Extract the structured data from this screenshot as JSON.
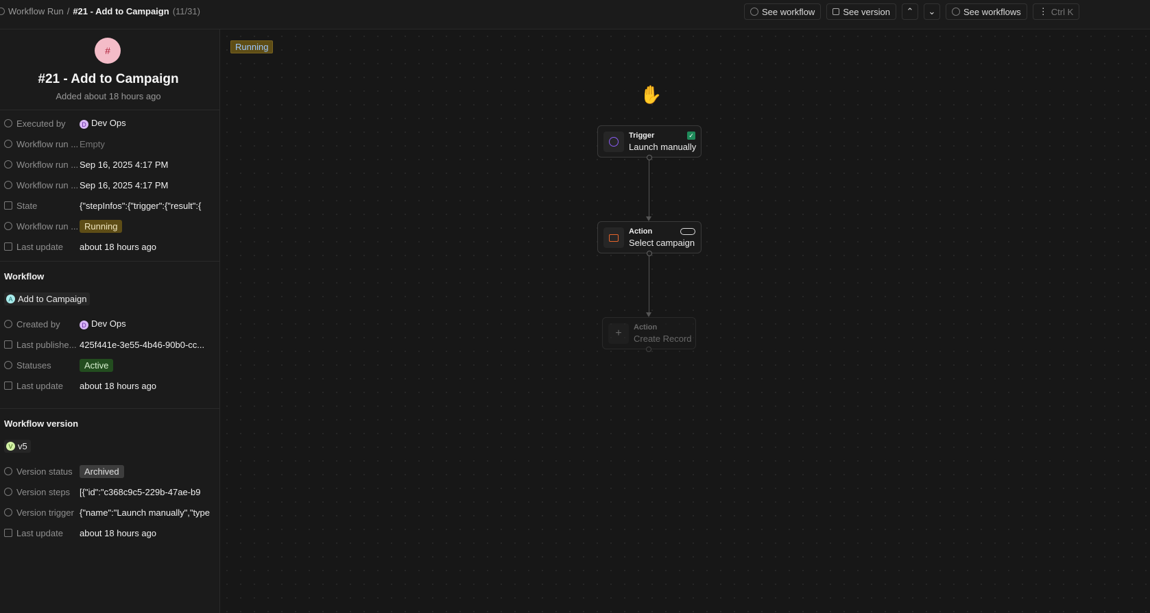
{
  "header": {
    "breadcrumb_root": "Workflow Run",
    "separator": "/",
    "title": "#21 - Add to Campaign",
    "count": "(11/31)",
    "buttons": {
      "see_workflow": "See workflow",
      "see_version": "See version",
      "see_workflows": "See workflows",
      "shortcut": "Ctrl K"
    }
  },
  "record": {
    "avatar": "#",
    "title": "#21 - Add to Campaign",
    "subtitle": "Added about 18 hours ago",
    "fields": [
      {
        "label": "Executed by",
        "value": "Dev Ops",
        "avatar": "D"
      },
      {
        "label": "Workflow run ...",
        "value": "Empty"
      },
      {
        "label": "Workflow run ...",
        "value": "Sep 16, 2025 4:17 PM"
      },
      {
        "label": "Workflow run ...",
        "value": "Sep 16, 2025 4:17 PM"
      },
      {
        "label": "State",
        "value": "{\"stepInfos\":{\"trigger\":{\"result\":{"
      },
      {
        "label": "Workflow run ...",
        "value": "Running"
      },
      {
        "label": "Last update",
        "value": "about 18 hours ago"
      }
    ]
  },
  "workflow": {
    "heading": "Workflow",
    "chip": "Add to Campaign",
    "chip_avatar": "A",
    "fields": [
      {
        "label": "Created by",
        "value": "Dev Ops",
        "avatar": "D"
      },
      {
        "label": "Last publishe...",
        "value": "425f441e-3e55-4b46-90b0-cc..."
      },
      {
        "label": "Statuses",
        "value": "Active"
      },
      {
        "label": "Last update",
        "value": "about 18 hours ago"
      }
    ]
  },
  "version": {
    "heading": "Workflow version",
    "chip": "v5",
    "chip_avatar": "V",
    "fields": [
      {
        "label": "Version status",
        "value": "Archived"
      },
      {
        "label": "Version steps",
        "value": "[{\"id\":\"c368c9c5-229b-47ae-b9"
      },
      {
        "label": "Version trigger",
        "value": "{\"name\":\"Launch manually\",\"type"
      },
      {
        "label": "Last update",
        "value": "about 18 hours ago"
      }
    ]
  },
  "canvas": {
    "status": "Running",
    "nodes": [
      {
        "kind": "Trigger",
        "name": "Launch manually"
      },
      {
        "kind": "Action",
        "name": "Select campaign"
      },
      {
        "kind": "Action",
        "name": "Create Record"
      }
    ]
  },
  "colors": {
    "running": "#5e4d16",
    "active": "#234d1f",
    "archived": "#3d3d3d",
    "trigger": "#8b5cf6",
    "action": "#e8652b"
  }
}
